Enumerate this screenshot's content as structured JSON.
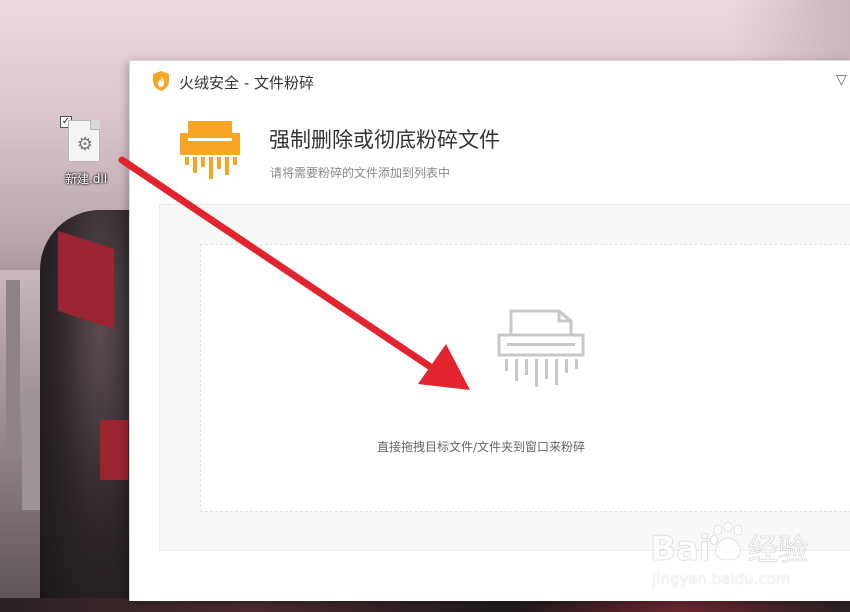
{
  "desktop": {
    "icon_label": "新建.dll",
    "icon_checked": "✓"
  },
  "window": {
    "title": "火绒安全 - 文件粉碎",
    "title_button_glyph": "▽"
  },
  "header": {
    "title": "强制删除或彻底粉碎文件",
    "subtitle": "请将需要粉碎的文件添加到列表中"
  },
  "dropzone": {
    "hint": "直接拖拽目标文件/文件夹到窗口来粉碎"
  },
  "watermark": {
    "brand": "Baidu经验",
    "url": "jingyan.baidu.com"
  },
  "colors": {
    "accent": "#f6a623",
    "arrow": "#e3232e",
    "dropzone_icon": "#c7c7c7"
  },
  "icons": {
    "app_logo": "flame-shield-icon",
    "header": "shredder-icon",
    "dropzone": "shredder-outline-icon",
    "desktop_file": "dll-file-icon"
  }
}
